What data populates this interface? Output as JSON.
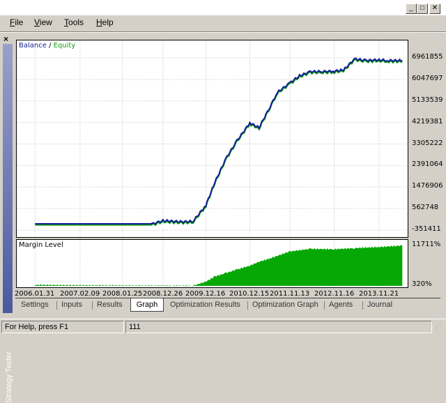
{
  "window": {
    "minimize_glyph": "_",
    "maximize_glyph": "□",
    "close_glyph": "✕"
  },
  "menu": {
    "items": [
      {
        "first": "F",
        "rest": "ile"
      },
      {
        "first": "V",
        "rest": "iew"
      },
      {
        "first": "T",
        "rest": "ools"
      },
      {
        "first": "H",
        "rest": "elp"
      }
    ]
  },
  "sidebar": {
    "close_glyph": "×",
    "label": "Strategy Tester"
  },
  "legend": {
    "balance": "Balance",
    "separator": " / ",
    "equity": "Equity"
  },
  "colors": {
    "balance": "#0f1f96",
    "equity": "#139c13",
    "margin_fill": "#06a806",
    "grid": "#c0c0c0"
  },
  "chart_data": [
    {
      "type": "line",
      "title": "",
      "series": [
        {
          "name": "Balance",
          "color": "#0f1f96"
        },
        {
          "name": "Equity",
          "color": "#139c13"
        }
      ],
      "x": [
        "2006.01.31",
        "2007.02.09",
        "2008.01.25",
        "2008.06.01",
        "2008.10.01",
        "2008.12.26",
        "2009.06.01",
        "2009.09.01",
        "2009.12.16",
        "2010.03.01",
        "2010.06.01",
        "2010.09.01",
        "2010.12.15",
        "2011.03.01",
        "2011.06.01",
        "2011.08.01",
        "2011.11.13",
        "2012.02.01",
        "2012.05.01",
        "2012.08.01",
        "2012.11.16",
        "2013.02.01",
        "2013.05.01",
        "2013.08.01",
        "2013.11.21",
        "2014.02.01",
        "2014.06.01"
      ],
      "y": [
        -85000,
        -85000,
        -85000,
        -85000,
        -85000,
        50000,
        0,
        20000,
        700000,
        1700000,
        2700000,
        3450000,
        4200000,
        4000000,
        4900000,
        5500000,
        5900000,
        6200000,
        6380000,
        6380000,
        6400000,
        6450000,
        6920000,
        6850000,
        6880000,
        6850000,
        6850000
      ],
      "y_ticks": [
        "6961855",
        "6047697",
        "5133539",
        "4219381",
        "3305222",
        "2391064",
        "1476906",
        "562748",
        "-351411"
      ],
      "ylim": [
        -351411,
        6961855
      ]
    },
    {
      "type": "area",
      "title": "Margin Level",
      "x": [
        "2006.01.31",
        "2007.02.09",
        "2008.01.25",
        "2008.12.26",
        "2009.09.01",
        "2009.12.16",
        "2010.03.01",
        "2010.06.01",
        "2010.09.01",
        "2010.12.15",
        "2011.03.01",
        "2011.06.01",
        "2011.11.13",
        "2012.05.01",
        "2012.11.16",
        "2013.05.01",
        "2013.11.21",
        "2014.06.01"
      ],
      "y": [
        600,
        470,
        420,
        370,
        370,
        1450,
        2900,
        3800,
        4800,
        5800,
        6900,
        7800,
        9700,
        10400,
        10300,
        10600,
        10900,
        11300
      ],
      "y_ticks": [
        "11711%",
        "320%"
      ],
      "ylim": [
        320,
        11711
      ]
    }
  ],
  "x_axis_labels": [
    "2006.01.31",
    "2007.02.09",
    "2008.01.25",
    "2008.12.26",
    "2009.12.16",
    "2010.12.15",
    "2011.11.13",
    "2012.11.16",
    "2013.11.21"
  ],
  "tabs": [
    "Settings",
    "Inputs",
    "Results",
    "Graph",
    "Optimization Results",
    "Optimization Graph",
    "Agents",
    "Journal"
  ],
  "active_tab": "Graph",
  "status": {
    "help": "For Help, press F1",
    "value": "111"
  }
}
